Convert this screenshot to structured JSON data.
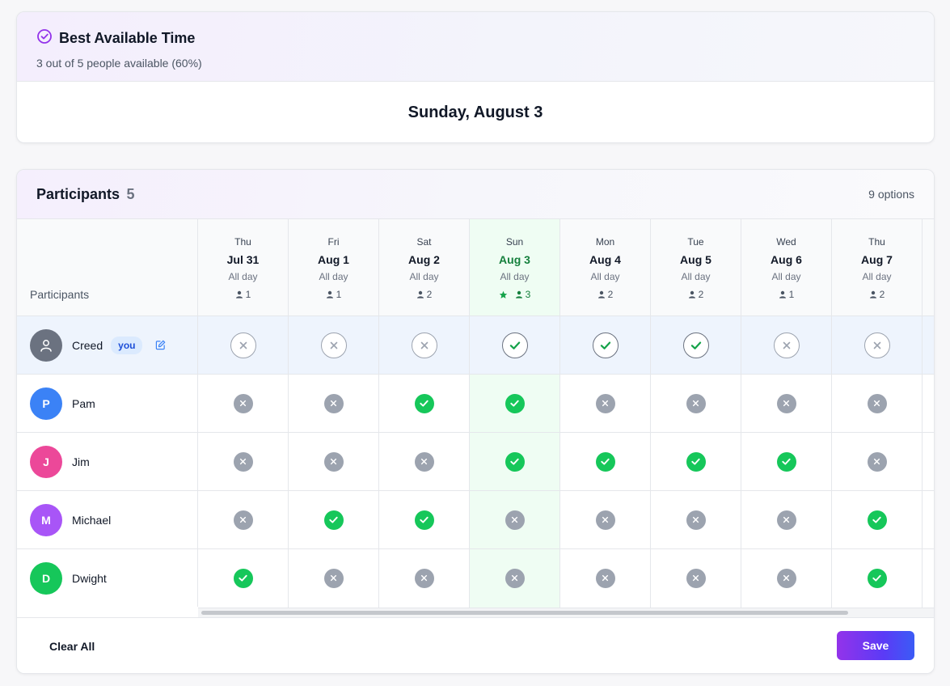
{
  "best": {
    "title": "Best Available Time",
    "subtitle": "3 out of 5 people available (60%)",
    "date": "Sunday, August 3"
  },
  "participants_panel": {
    "title": "Participants",
    "count": "5",
    "options": "9 options",
    "column_header": "Participants",
    "clear_label": "Clear All",
    "save_label": "Save"
  },
  "days": [
    {
      "dow": "Thu",
      "date": "Jul 31",
      "allday": "All day",
      "count": "1"
    },
    {
      "dow": "Fri",
      "date": "Aug 1",
      "allday": "All day",
      "count": "1"
    },
    {
      "dow": "Sat",
      "date": "Aug 2",
      "allday": "All day",
      "count": "2"
    },
    {
      "dow": "Sun",
      "date": "Aug 3",
      "allday": "All day",
      "count": "3"
    },
    {
      "dow": "Mon",
      "date": "Aug 4",
      "allday": "All day",
      "count": "2"
    },
    {
      "dow": "Tue",
      "date": "Aug 5",
      "allday": "All day",
      "count": "2"
    },
    {
      "dow": "Wed",
      "date": "Aug 6",
      "allday": "All day",
      "count": "1"
    },
    {
      "dow": "Thu",
      "date": "Aug 7",
      "allday": "All day",
      "count": "2"
    }
  ],
  "best_day_index": 3,
  "people": [
    {
      "name": "Creed",
      "initial": "",
      "avatar_color": "#6b7280",
      "you_label": "you",
      "is_you": true,
      "availability": [
        false,
        false,
        false,
        true,
        true,
        true,
        false,
        false
      ]
    },
    {
      "name": "Pam",
      "initial": "P",
      "avatar_color": "#3b82f6",
      "is_you": false,
      "availability": [
        false,
        false,
        true,
        true,
        false,
        false,
        false,
        false
      ]
    },
    {
      "name": "Jim",
      "initial": "J",
      "avatar_color": "#ec4899",
      "is_you": false,
      "availability": [
        false,
        false,
        false,
        true,
        true,
        true,
        true,
        false
      ]
    },
    {
      "name": "Michael",
      "initial": "M",
      "avatar_color": "#a855f7",
      "is_you": false,
      "availability": [
        false,
        true,
        true,
        false,
        false,
        false,
        false,
        true
      ]
    },
    {
      "name": "Dwight",
      "initial": "D",
      "avatar_color": "#16c75a",
      "is_you": false,
      "availability": [
        true,
        false,
        false,
        false,
        false,
        false,
        false,
        true
      ]
    }
  ],
  "colors": {
    "accent": "#9333ea",
    "available": "#16c75a",
    "unavailable": "#9ca3af",
    "best_highlight": "#effdf3"
  },
  "icons": {
    "best_title": "check-circle-icon",
    "person": "person-icon",
    "star": "star-icon",
    "edit": "edit-icon",
    "available": "check-icon",
    "unavailable": "x-icon"
  }
}
